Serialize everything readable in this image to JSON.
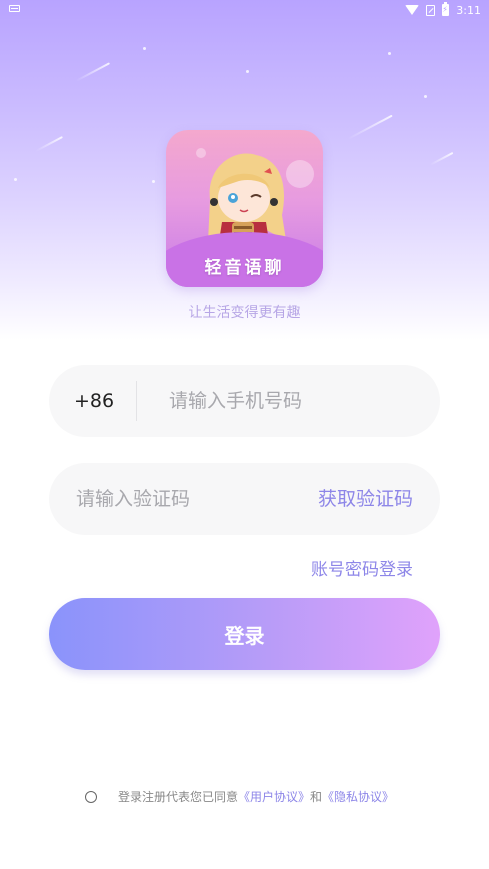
{
  "status_bar": {
    "time": "3:11"
  },
  "app": {
    "name": "轻音语聊",
    "tagline": "让生活变得更有趣"
  },
  "login": {
    "country_code": "+86",
    "phone_placeholder": "请输入手机号码",
    "code_placeholder": "请输入验证码",
    "get_code_label": "获取验证码",
    "account_login_label": "账号密码登录",
    "submit_label": "登录"
  },
  "agreement": {
    "prefix": "登录注册代表您已同意",
    "user_agreement": "《用户协议》",
    "conjunction": "和",
    "privacy_policy": "《隐私协议》"
  },
  "colors": {
    "accent": "#8d86e8",
    "button_start": "#8a93fb",
    "button_end": "#e0a2fb"
  }
}
